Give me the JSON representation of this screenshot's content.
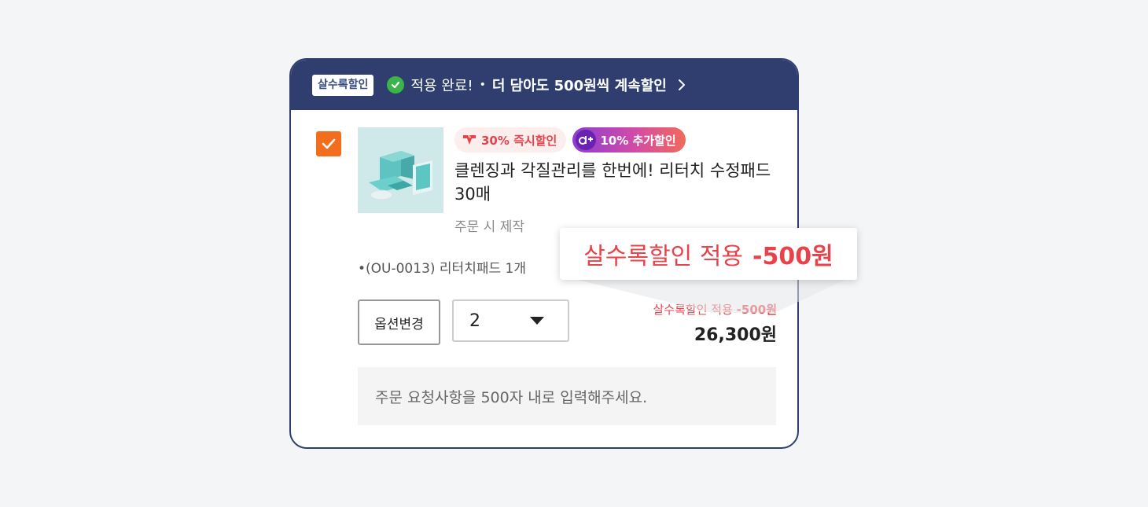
{
  "banner": {
    "tag": "살수록할인",
    "status": "적용 완료!",
    "separator": "•",
    "promo": "더 담아도 500원씩 계속할인"
  },
  "product": {
    "badges": {
      "instant": "30% 즉시할인",
      "extra": "10% 추가할인"
    },
    "title": "클렌징과 각질관리를 한번에! 리터치 수정패드 30매",
    "made_to_order": "주문 시 제작",
    "option": "•(OU-0013) 리터치패드 1개",
    "change_option_label": "옵션변경",
    "quantity": "2",
    "discount_note_label": "살수록할인 적용",
    "discount_note_amount": "-500원",
    "price": "26,300원",
    "request_placeholder": "주문 요청사항을 500자 내로 입력해주세요."
  },
  "callout": {
    "label": "살수록할인 적용",
    "amount": "-500원"
  },
  "colors": {
    "banner_bg": "#2f3e6f",
    "accent_red": "#e8424a",
    "checkbox_orange": "#f26d1c",
    "check_green": "#3bb54a"
  }
}
